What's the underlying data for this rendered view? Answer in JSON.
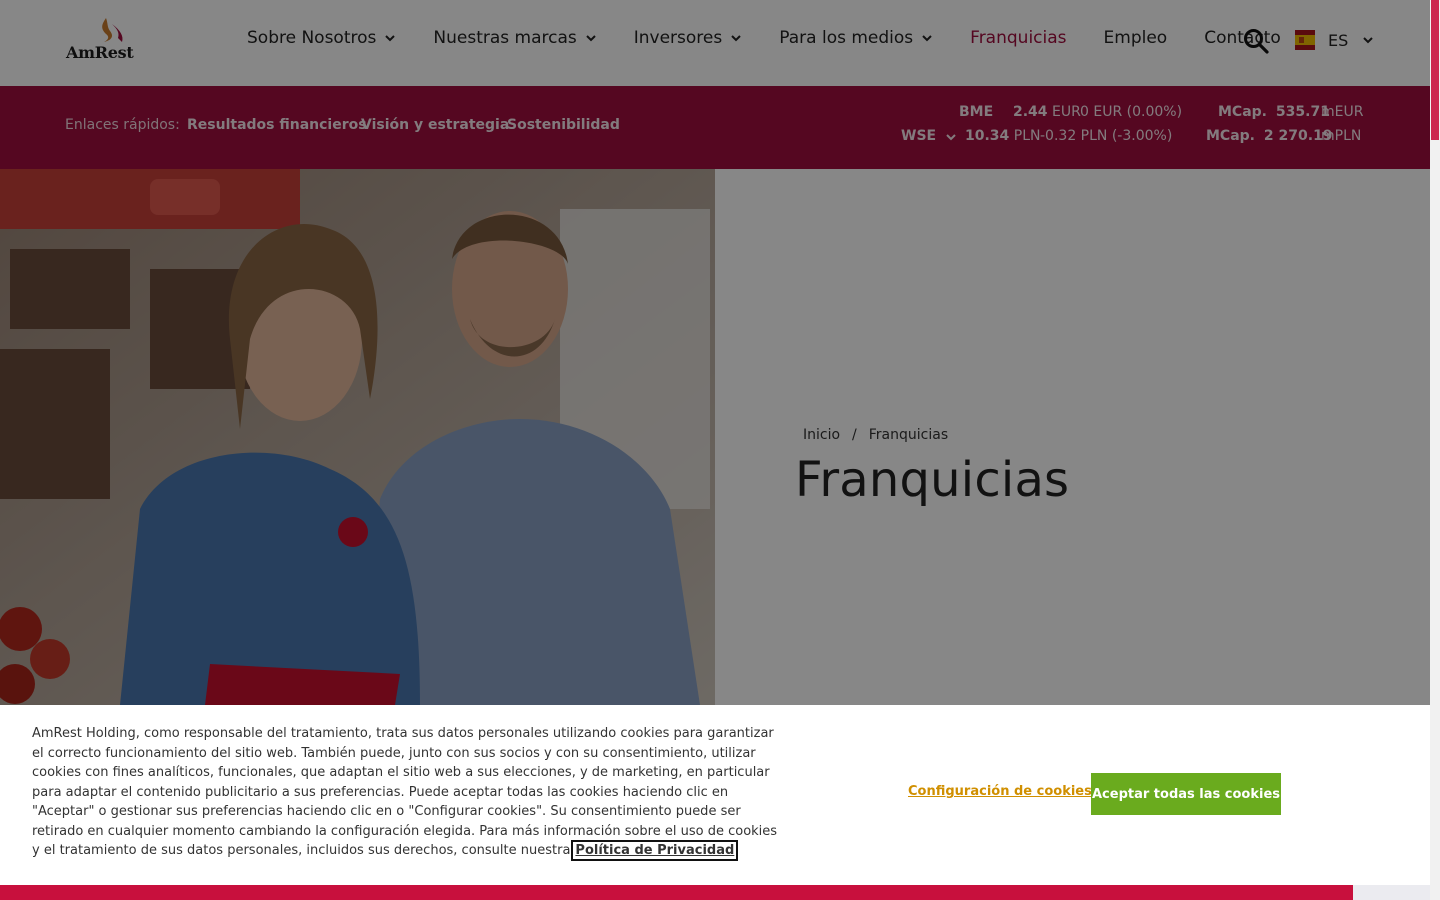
{
  "header": {
    "logo_text": "AmRest",
    "nav": [
      {
        "label": "Sobre Nosotros",
        "has_dropdown": true
      },
      {
        "label": "Nuestras marcas",
        "has_dropdown": true
      },
      {
        "label": "Inversores",
        "has_dropdown": true
      },
      {
        "label": "Para los medios",
        "has_dropdown": true
      },
      {
        "label": "Franquicias",
        "has_dropdown": false,
        "active": true
      },
      {
        "label": "Empleo",
        "has_dropdown": false
      },
      {
        "label": "Contacto",
        "has_dropdown": false
      }
    ],
    "language": "ES",
    "search_icon": "search-icon"
  },
  "quick_links": {
    "label": "Enlaces rápidos:",
    "links": [
      "Resultados financieros",
      "Visión y estrategia",
      "Sostenibilidad"
    ]
  },
  "stocks": {
    "bme": {
      "exchange": "BME",
      "price": "2.44",
      "currency": "EUR",
      "change": "0 EUR (0.00%)",
      "mcap_label": "MCap.",
      "mcap": "535.71",
      "mcap_unit": "mEUR"
    },
    "wse": {
      "exchange": "WSE",
      "price": "10.34",
      "currency": "PLN",
      "change": "-0.32 PLN (-3.00%)",
      "mcap_label": "MCap.",
      "mcap": "2 270.19",
      "mcap_unit": "mPLN"
    }
  },
  "hero": {
    "breadcrumb": [
      "Inicio",
      "/",
      "Franquicias"
    ],
    "title": "Franquicias"
  },
  "cookie": {
    "text": "AmRest Holding, como responsable del tratamiento, trata sus datos personales utilizando cookies para garantizar el correcto funcionamiento del sitio web. También puede, junto con sus socios y con su consentimiento, utilizar cookies con fines analíticos, funcionales, que adaptan el sitio web a sus elecciones, y de marketing, en particular para adaptar el contenido publicitario a sus preferencias. Puede aceptar todas las cookies haciendo clic en \"Aceptar\" o gestionar sus preferencias haciendo clic en o \"Configurar cookies\". Su consentimiento puede ser retirado en cualquier momento cambiando la configuración elegida. Para más información sobre el uso de cookies y el tratamiento de sus datos personales, incluidos sus derechos, consulte nuestra",
    "privacy_link": "Política de Privacidad",
    "settings_label": "Configuración de cookies",
    "accept_label": "Aceptar todas las cookies"
  },
  "colors": {
    "brand": "#a10f3f",
    "accept_button": "#6aab1e",
    "settings_link": "#d08f00"
  }
}
